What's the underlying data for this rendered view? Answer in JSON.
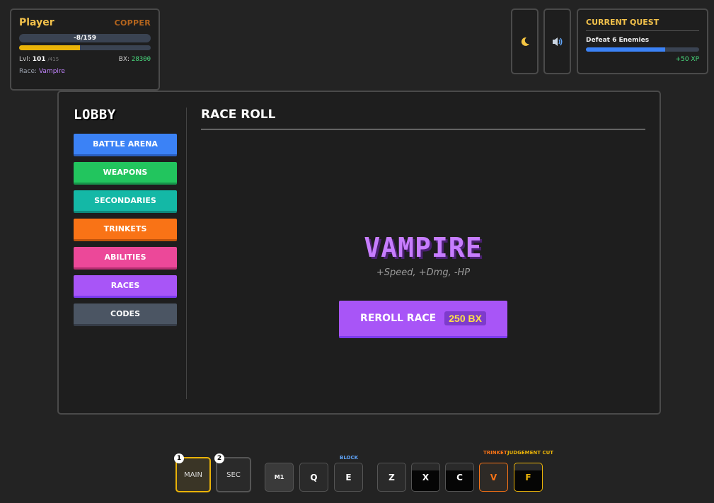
{
  "player": {
    "name": "Player",
    "rank": "COPPER",
    "xp_text": "-8/159",
    "level_progress": 0.46,
    "level_label": "Lvl:",
    "level": "101",
    "level_max": "/415",
    "bx_label": "BX:",
    "bx": "28300",
    "race_label": "Race:",
    "race": "Vampire"
  },
  "icons": {
    "theme": "moon-icon",
    "sound": "speaker-icon"
  },
  "quest": {
    "title": "CURRENT QUEST",
    "text": "Defeat 6 Enemies",
    "progress": 0.7,
    "reward": "+50 XP"
  },
  "lobby": {
    "title": "LOBBY",
    "nav": [
      {
        "label": "BATTLE ARENA",
        "color": "#3b82f6",
        "shade": "#2a5fc0"
      },
      {
        "label": "WEAPONS",
        "color": "#22c55e",
        "shade": "#17944a"
      },
      {
        "label": "SECONDARIES",
        "color": "#14b8a6",
        "shade": "#0e8a7c"
      },
      {
        "label": "TRINKETS",
        "color": "#f97316",
        "shade": "#c0540c"
      },
      {
        "label": "ABILITIES",
        "color": "#ec4899",
        "shade": "#b62f72"
      },
      {
        "label": "RACES",
        "color": "#a855f7",
        "shade": "#7c3aed"
      },
      {
        "label": "CODES",
        "color": "#4b5563",
        "shade": "#353c47"
      }
    ]
  },
  "race_roll": {
    "title": "RACE ROLL",
    "race_name": "VAMPIRE",
    "race_desc": "+Speed, +Dmg, -HP",
    "reroll_label": "REROLL RACE",
    "cost": "250 BX"
  },
  "hotbar": {
    "weapons": [
      {
        "num": "1",
        "label": "MAIN",
        "active": true
      },
      {
        "num": "2",
        "label": "SEC",
        "active": false
      }
    ],
    "keys": [
      {
        "key": "M1",
        "tag": ""
      },
      {
        "key": "Q",
        "tag": ""
      },
      {
        "key": "E",
        "tag": "BLOCK"
      },
      {
        "key": "Z",
        "tag": ""
      },
      {
        "key": "X",
        "tag": ""
      },
      {
        "key": "C",
        "tag": ""
      },
      {
        "key": "V",
        "tag": "TRINKET"
      },
      {
        "key": "F",
        "tag": "JUDGEMENT CUT"
      }
    ]
  }
}
